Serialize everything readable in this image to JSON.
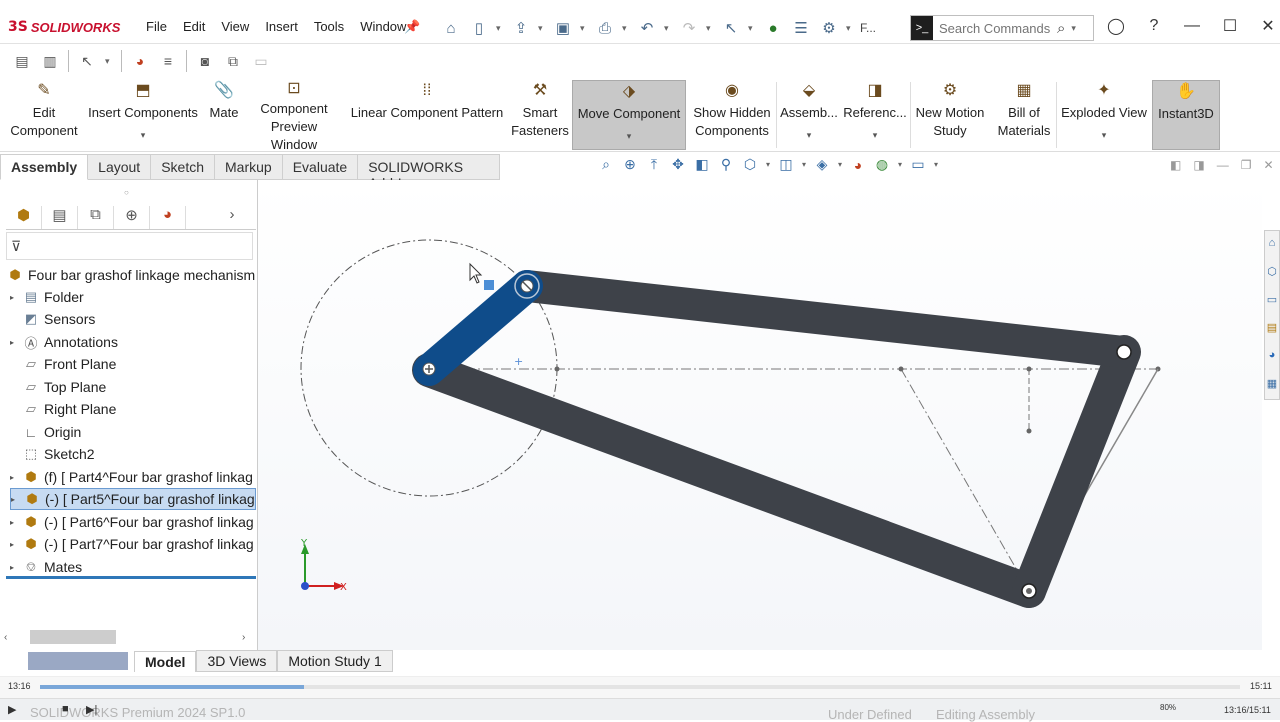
{
  "app": {
    "brand": "SOLIDWORKS",
    "brand_mark": "3S"
  },
  "menu": [
    "File",
    "Edit",
    "View",
    "Insert",
    "Tools",
    "Window"
  ],
  "quickbar": {
    "truncated_label": "F..."
  },
  "search": {
    "placeholder": "Search Commands"
  },
  "ribbon": [
    {
      "label": "Edit Component",
      "icon": "edit-component-icon"
    },
    {
      "label": "Insert Components",
      "icon": "insert-components-icon"
    },
    {
      "label": "Mate",
      "icon": "mate-icon"
    },
    {
      "label": "Component Preview Window",
      "icon": "preview-window-icon"
    },
    {
      "label": "Linear Component Pattern",
      "icon": "linear-pattern-icon"
    },
    {
      "label": "Smart Fasteners",
      "icon": "smart-fasteners-icon"
    },
    {
      "label": "Move Component",
      "icon": "move-component-icon"
    },
    {
      "label": "Show Hidden Components",
      "icon": "show-hidden-icon"
    },
    {
      "label": "Assemb...",
      "icon": "assembly-features-icon"
    },
    {
      "label": "Referenc...",
      "icon": "reference-geometry-icon"
    },
    {
      "label": "New Motion Study",
      "icon": "motion-study-icon"
    },
    {
      "label": "Bill of Materials",
      "icon": "bill-of-materials-icon"
    },
    {
      "label": "Exploded View",
      "icon": "exploded-view-icon"
    },
    {
      "label": "Instant3D",
      "icon": "instant3d-icon"
    }
  ],
  "tabs": [
    "Assembly",
    "Layout",
    "Sketch",
    "Markup",
    "Evaluate",
    "SOLIDWORKS Add-Ins"
  ],
  "tree": {
    "root": "Four bar grashof linkage mechanism",
    "items": [
      {
        "label": "Folder"
      },
      {
        "label": "Sensors"
      },
      {
        "label": "Annotations"
      },
      {
        "label": "Front Plane"
      },
      {
        "label": "Top Plane"
      },
      {
        "label": "Right Plane"
      },
      {
        "label": "Origin"
      },
      {
        "label": "Sketch2"
      },
      {
        "label": "(f) [ Part4^Four bar grashof linkag"
      },
      {
        "label": "(-) [ Part5^Four bar grashof linkag"
      },
      {
        "label": "(-) [ Part6^Four bar grashof linkag"
      },
      {
        "label": "(-) [ Part7^Four bar grashof linkag"
      },
      {
        "label": "Mates"
      }
    ]
  },
  "bottom_tabs": [
    "Model",
    "3D Views",
    "Motion Study 1"
  ],
  "timeline": {
    "start": "13:16",
    "end": "15:11",
    "progress": 0.22
  },
  "status": {
    "product": "SOLIDWORKS Premium 2024 SP1.0",
    "definition": "Under Defined",
    "mode": "Editing Assembly",
    "zoom": "80%",
    "time": "13:16/15:11"
  },
  "triad": {
    "x": "X",
    "y": "Y"
  },
  "colors": {
    "link": "#3e4249",
    "selected_link": "#0f4c8a",
    "accent": "#2e77b8",
    "brand": "#c8102e"
  }
}
